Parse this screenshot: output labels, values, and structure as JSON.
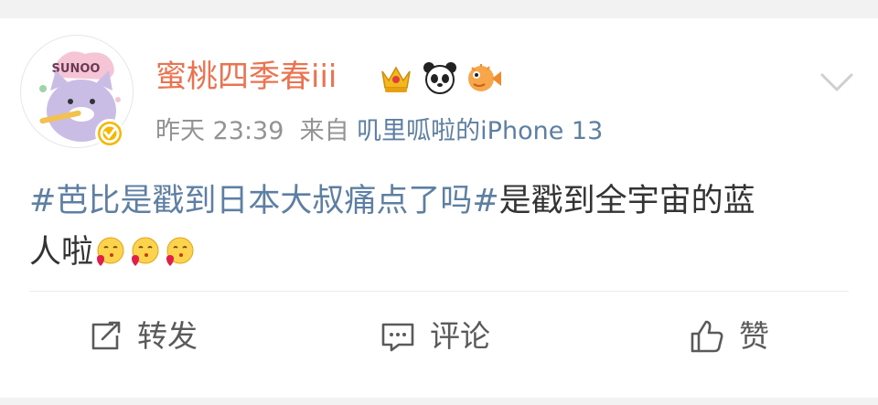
{
  "post": {
    "author": "蜜桃四季春iii",
    "timestamp": "昨天 23:39",
    "source_prefix": "来自",
    "source_name": "叽里呱啦的iPhone 13",
    "text_parts": {
      "topic": "#芭比是戳到日本大叔痛点了吗#",
      "body_line1": "是戳到全宇宙的蓝",
      "body_line2": "人啦"
    },
    "emoji_names": [
      "heart-kiss-emoji",
      "heart-kiss-emoji",
      "heart-kiss-emoji"
    ],
    "badge_icons": [
      "crown-badge-icon",
      "panda-badge-icon",
      "pufferfish-badge-icon"
    ],
    "avatar_sticker_text": "SUNOO"
  },
  "actions": {
    "repost_label": "转发",
    "comment_label": "评论",
    "like_label": "赞"
  },
  "colors": {
    "username": "#eb7350",
    "link": "#5d7fa3",
    "meta": "#939393",
    "verified": "#f5b800"
  }
}
